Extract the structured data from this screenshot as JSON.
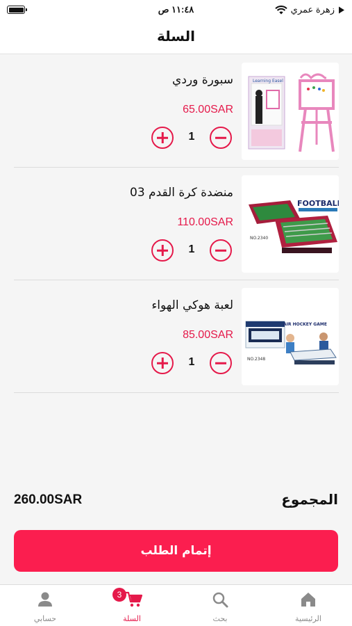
{
  "status_bar": {
    "time": "١١:٤٨ ص",
    "carrier": "زهرة عمري",
    "icons": [
      "battery-icon",
      "wifi-icon",
      "navigation-arrow-icon"
    ]
  },
  "header": {
    "title": "السلة"
  },
  "cart": {
    "items": [
      {
        "name": "سبورة وردي",
        "price": "65.00SAR",
        "quantity": "1",
        "image": "pink-easel-whiteboard-image",
        "image_text": "Learning Easel"
      },
      {
        "name": "منضدة كرة القدم 03",
        "price": "110.00SAR",
        "quantity": "1",
        "image": "foosball-table-image",
        "image_text": "FOOTBALL",
        "image_code": "NO.2340"
      },
      {
        "name": "لعبة هوكي الهواء",
        "price": "85.00SAR",
        "quantity": "1",
        "image": "air-hockey-table-image",
        "image_text": "AIR HOCKEY GAME",
        "image_code": "NO.2348"
      }
    ]
  },
  "total": {
    "label": "المجموع",
    "value": "260.00SAR"
  },
  "checkout": {
    "label": "إتمام الطلب"
  },
  "tabbar": {
    "tabs": [
      {
        "id": "home",
        "label": "الرئيسية",
        "icon": "home-icon",
        "active": false
      },
      {
        "id": "search",
        "label": "بحث",
        "icon": "search-icon",
        "active": false
      },
      {
        "id": "cart",
        "label": "السلة",
        "icon": "cart-icon",
        "active": true,
        "badge": "3"
      },
      {
        "id": "account",
        "label": "حسابي",
        "icon": "person-icon",
        "active": false
      }
    ]
  },
  "colors": {
    "accent": "#e5194a",
    "checkout_button": "#fb1e4f",
    "inactive_tab": "#8a8a8a",
    "background": "#f5f5f5"
  }
}
